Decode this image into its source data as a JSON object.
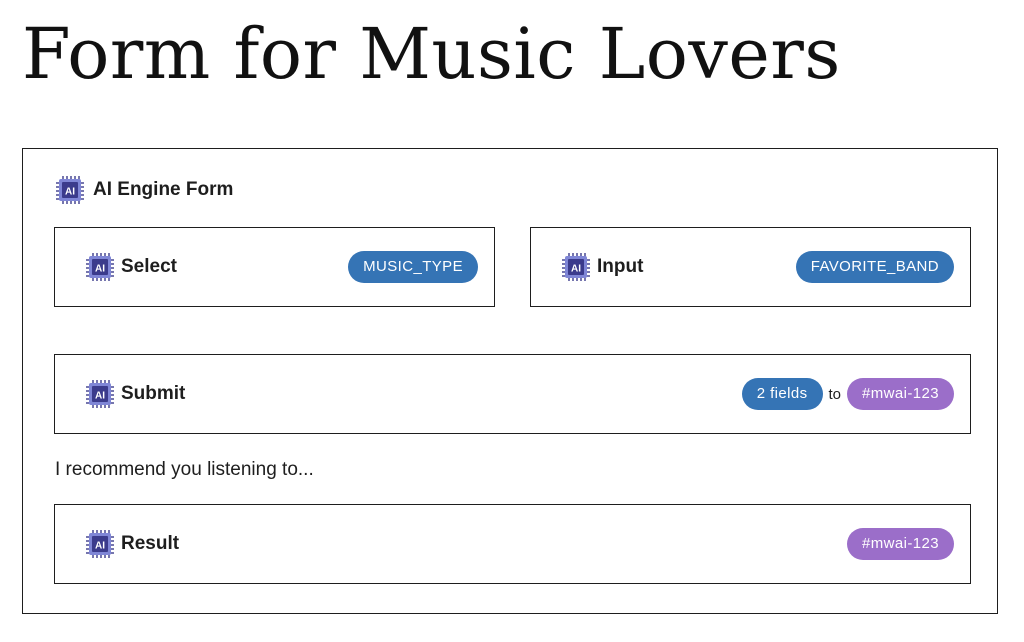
{
  "page": {
    "title": "Form for Music Lovers"
  },
  "form": {
    "header_label": "AI Engine Form",
    "select_block": {
      "label": "Select",
      "field_badge": "MUSIC_TYPE"
    },
    "input_block": {
      "label": "Input",
      "field_badge": "FAVORITE_BAND"
    },
    "submit_block": {
      "label": "Submit",
      "fields_badge": "2 fields",
      "to_text": "to",
      "target_badge": "#mwai-123"
    },
    "paragraph": "I recommend you listening to...",
    "result_block": {
      "label": "Result",
      "target_badge": "#mwai-123"
    }
  },
  "icons": {
    "block_icon": "ai-chip-icon"
  },
  "colors": {
    "badge_blue": "#3574b5",
    "badge_purple": "#9b6ec9",
    "chip_dark": "#3b3b8c",
    "chip_light": "#7f86d6",
    "border": "#1e1e1e"
  }
}
